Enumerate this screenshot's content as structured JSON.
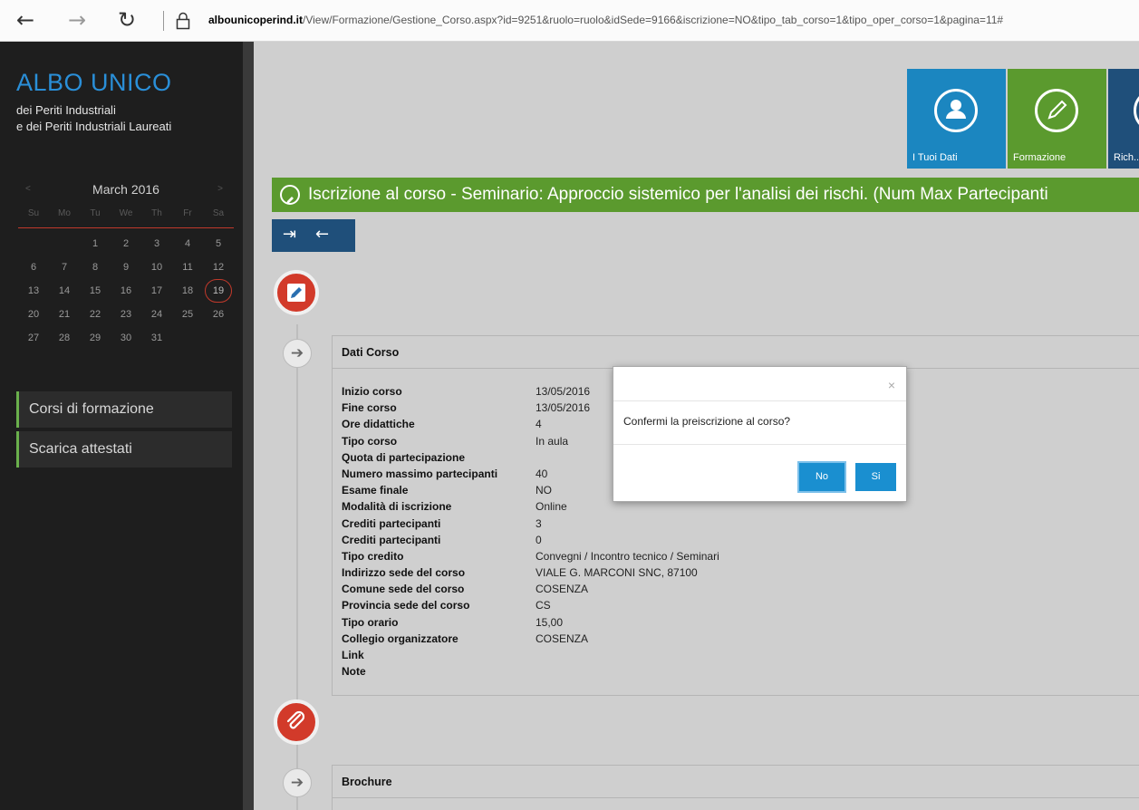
{
  "browser": {
    "back": "←",
    "forward": "→",
    "reload": "↻",
    "lock": "🔒",
    "url_domain": "albounicoperind.it",
    "url_path": "/View/Formazione/Gestione_Corso.aspx?id=9251&ruolo=ruolo&idSede=9166&iscrizione=NO&tipo_tab_corso=1&tipo_oper_corso=1&pagina=11#"
  },
  "sidebar": {
    "title": "ALBO UNICO",
    "subtitle1": "dei Periti Industriali",
    "subtitle2": "e dei Periti Industriali Laureati",
    "calendar": {
      "month": "March 2016",
      "prev": "<",
      "next": ">",
      "dow": [
        "Su",
        "Mo",
        "Tu",
        "We",
        "Th",
        "Fr",
        "Sa"
      ],
      "weeks": [
        [
          "",
          "",
          "1",
          "2",
          "3",
          "4",
          "5"
        ],
        [
          "6",
          "7",
          "8",
          "9",
          "10",
          "11",
          "12"
        ],
        [
          "13",
          "14",
          "15",
          "16",
          "17",
          "18",
          "19"
        ],
        [
          "20",
          "21",
          "22",
          "23",
          "24",
          "25",
          "26"
        ],
        [
          "27",
          "28",
          "29",
          "30",
          "31",
          "",
          ""
        ]
      ],
      "today": "19"
    },
    "menu": [
      {
        "label": "Corsi di formazione"
      },
      {
        "label": "Scarica attestati"
      }
    ]
  },
  "tiles": [
    {
      "label": "I Tuoi Dati",
      "color": "#1b86c0"
    },
    {
      "label": "Formazione",
      "color": "#5b9a2e"
    },
    {
      "label": "Rich...",
      "color": "#1f4f7a"
    }
  ],
  "banner": {
    "text": "Iscrizione al corso - Seminario: Approccio sistemico per l'analisi dei rischi. (Num Max Partecipanti"
  },
  "toolbar": {
    "enter": "⇥",
    "back": "←"
  },
  "dati_corso": {
    "title": "Dati Corso",
    "rows": [
      {
        "k": "Inizio corso",
        "v": "13/05/2016"
      },
      {
        "k": "Fine corso",
        "v": "13/05/2016"
      },
      {
        "k": "Ore didattiche",
        "v": "4"
      },
      {
        "k": "Tipo corso",
        "v": "In aula"
      },
      {
        "k": "Quota di partecipazione",
        "v": ""
      },
      {
        "k": "Numero massimo partecipanti",
        "v": "40"
      },
      {
        "k": "Esame finale",
        "v": "NO"
      },
      {
        "k": "Modalità di iscrizione",
        "v": "Online"
      },
      {
        "k": "Crediti partecipanti",
        "v": "3"
      },
      {
        "k": "Crediti partecipanti",
        "v": "0"
      },
      {
        "k": "Tipo credito",
        "v": "Convegni / Incontro tecnico / Seminari"
      },
      {
        "k": "Indirizzo sede del corso",
        "v": "VIALE G. MARCONI SNC, 87100"
      },
      {
        "k": "Comune sede del corso",
        "v": "COSENZA"
      },
      {
        "k": "Provincia sede del corso",
        "v": "CS"
      },
      {
        "k": "Tipo orario",
        "v": "15,00"
      },
      {
        "k": "Collegio organizzatore",
        "v": "COSENZA"
      },
      {
        "k": "Link",
        "v": ""
      },
      {
        "k": "Note",
        "v": ""
      }
    ]
  },
  "brochure": {
    "title": "Brochure"
  },
  "modal": {
    "close": "×",
    "message": "Confermi la preiscrizione al corso?",
    "no_label": "No",
    "si_label": "Si"
  }
}
